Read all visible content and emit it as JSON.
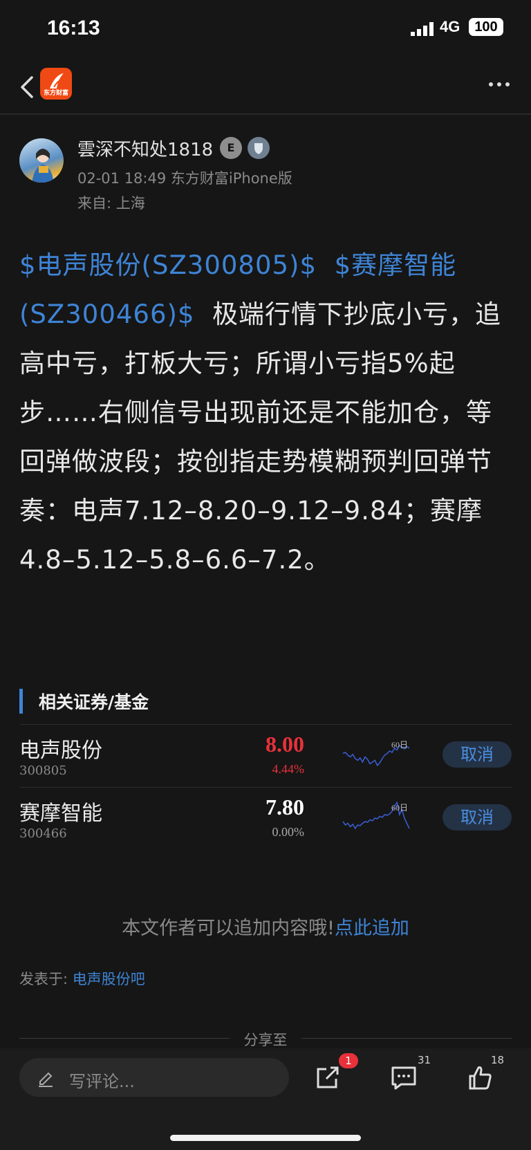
{
  "status": {
    "time": "16:13",
    "network": "4G",
    "battery": "100"
  },
  "nav": {
    "logo_text": "东方财富"
  },
  "author": {
    "name": "雲深不知处1818",
    "badge_text": "E",
    "meta": "02-01 18:49 东方财富iPhone版",
    "origin": "来自: 上海"
  },
  "post": {
    "stock1": "$电声股份(SZ300805)$",
    "stock2": "$赛摩智能(SZ300466)$",
    "body": "极端行情下抄底小亏，追高中亏，打板大亏；所谓小亏指5%起步……右侧信号出现前还是不能加仓，等回弹做波段；按创指走势模糊预判回弹节奏：电声7.12–8.20–9.12–9.84；赛摩4.8–5.12–5.8–6.6–7.2。"
  },
  "related": {
    "title": "相关证券/基金",
    "items": [
      {
        "name": "电声股份",
        "code": "300805",
        "price": "8.00",
        "change": "4.44%",
        "color": "#e8313a",
        "spark_label": "60日",
        "action": "取消",
        "spark": [
          0.55,
          0.58,
          0.5,
          0.45,
          0.52,
          0.4,
          0.35,
          0.42,
          0.3,
          0.45,
          0.38,
          0.25,
          0.3,
          0.35,
          0.2,
          0.28,
          0.4,
          0.5,
          0.55,
          0.62,
          0.58,
          0.7,
          0.65,
          0.78,
          0.72,
          0.68,
          0.75,
          0.7
        ]
      },
      {
        "name": "赛摩智能",
        "code": "300466",
        "price": "7.80",
        "change": "0.00%",
        "color": "#ffffff",
        "spark_label": "60日",
        "action": "取消",
        "spark": [
          0.4,
          0.3,
          0.35,
          0.25,
          0.32,
          0.2,
          0.3,
          0.28,
          0.35,
          0.4,
          0.38,
          0.45,
          0.42,
          0.5,
          0.48,
          0.55,
          0.52,
          0.6,
          0.58,
          0.62,
          0.7,
          0.85,
          0.95,
          0.6,
          0.75,
          0.5,
          0.35,
          0.2
        ]
      }
    ]
  },
  "add_tip": {
    "text": "本文作者可以追加内容哦!",
    "link": "点此追加"
  },
  "posted_in": {
    "label": "发表于: ",
    "forum": "电声股份吧"
  },
  "share": {
    "label": "分享至"
  },
  "bottom": {
    "placeholder": "写评论...",
    "share_badge": "1",
    "comment_count": "31",
    "like_count": "18"
  }
}
